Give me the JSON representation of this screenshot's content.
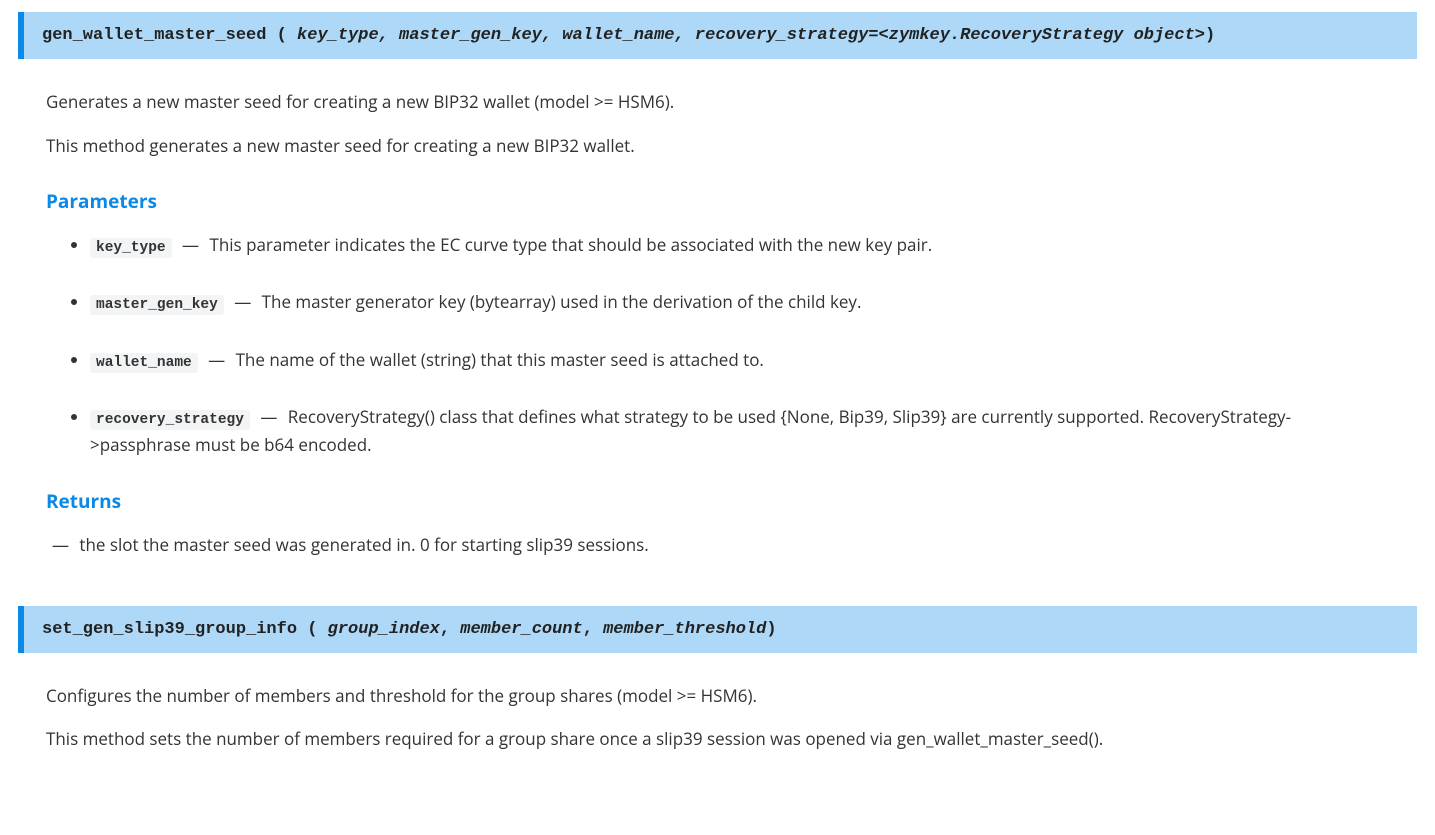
{
  "method1": {
    "name": "gen_wallet_master_seed",
    "paren_open": "(",
    "paren_close": ")",
    "args_joined": " key_type, master_gen_key, wallet_name, recovery_strategy=<zymkey.RecoveryStrategy object>",
    "desc1": "Generates a new master seed for creating a new BIP32 wallet (model >= HSM6).",
    "desc2": "This method generates a new master seed for creating a new BIP32 wallet.",
    "parameters_heading": "Parameters",
    "params": {
      "p0_name": "key_type",
      "p0_desc": "This parameter indicates the EC curve type that should be associated with the new key pair.",
      "p1_name": "master_gen_key",
      "p1_desc": "The master generator key (bytearray) used in the derivation of the child key.",
      "p2_name": "wallet_name",
      "p2_desc": "The name of the wallet (string) that this master seed is attached to.",
      "p3_name": "recovery_strategy",
      "p3_desc": "RecoveryStrategy() class that defines what strategy to be used {None, Bip39, Slip39} are currently supported. RecoveryStrategy->passphrase must be b64 encoded."
    },
    "returns_heading": "Returns",
    "returns_text": "the slot the master seed was generated in. 0 for starting slip39 sessions."
  },
  "method2": {
    "name": "set_gen_slip39_group_info",
    "paren_open": "(",
    "paren_close": ")",
    "arg0": "group_index",
    "arg1": "member_count",
    "arg2": "member_threshold",
    "comma": ",",
    "desc1": "Configures the number of members and threshold for the group shares (model >= HSM6).",
    "desc2": "This method sets the number of members required for a group share once a slip39 session was opened via gen_wallet_master_seed()."
  },
  "emdash": "—"
}
